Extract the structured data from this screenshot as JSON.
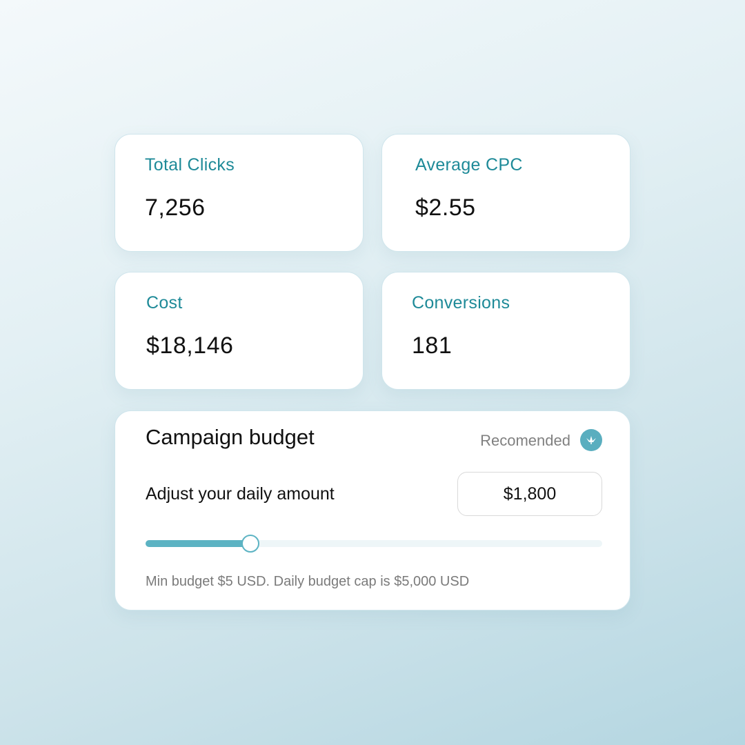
{
  "stats": [
    {
      "label": "Total Clicks",
      "value": "7,256"
    },
    {
      "label": "Average CPC",
      "value": "$2.55"
    },
    {
      "label": "Cost",
      "value": "$18,146"
    },
    {
      "label": "Conversions",
      "value": "181"
    }
  ],
  "budget": {
    "title": "Campaign budget",
    "recommended_label": "Recomended",
    "recommended_icon": "bird-icon",
    "adjust_label": "Adjust your daily amount",
    "amount_value": "$1,800",
    "slider_fraction": 0.23,
    "hint": "Min budget $5 USD. Daily budget cap is $5,000 USD"
  },
  "colors": {
    "accent": "#1e8a98",
    "slider": "#5cb3c3",
    "icon_bg": "#5aaebf"
  }
}
